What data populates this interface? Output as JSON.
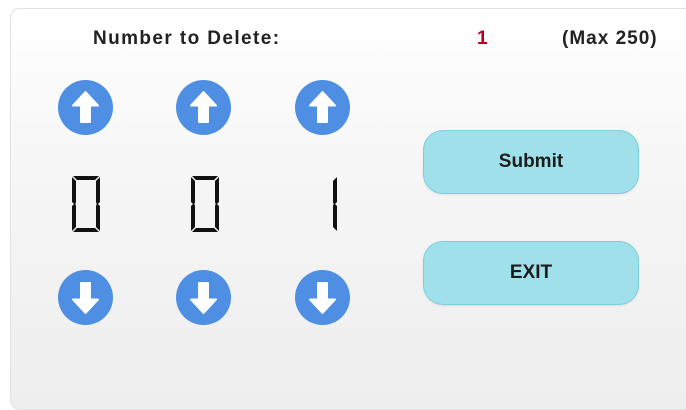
{
  "header": {
    "label": "Number to Delete:",
    "current_value": "1",
    "max_label": "(Max 250)"
  },
  "digits": [
    {
      "value": 0,
      "display": "0"
    },
    {
      "value": 0,
      "display": "0"
    },
    {
      "value": 1,
      "display": "1"
    }
  ],
  "buttons": {
    "submit_label": "Submit",
    "exit_label": "EXIT"
  },
  "icons": {
    "increment": "arrow-up-icon",
    "decrement": "arrow-down-icon"
  },
  "colors": {
    "arrow_circle": "#4f8fe3",
    "current_value": "#b4001e",
    "action_button": "#9fe0ea"
  }
}
